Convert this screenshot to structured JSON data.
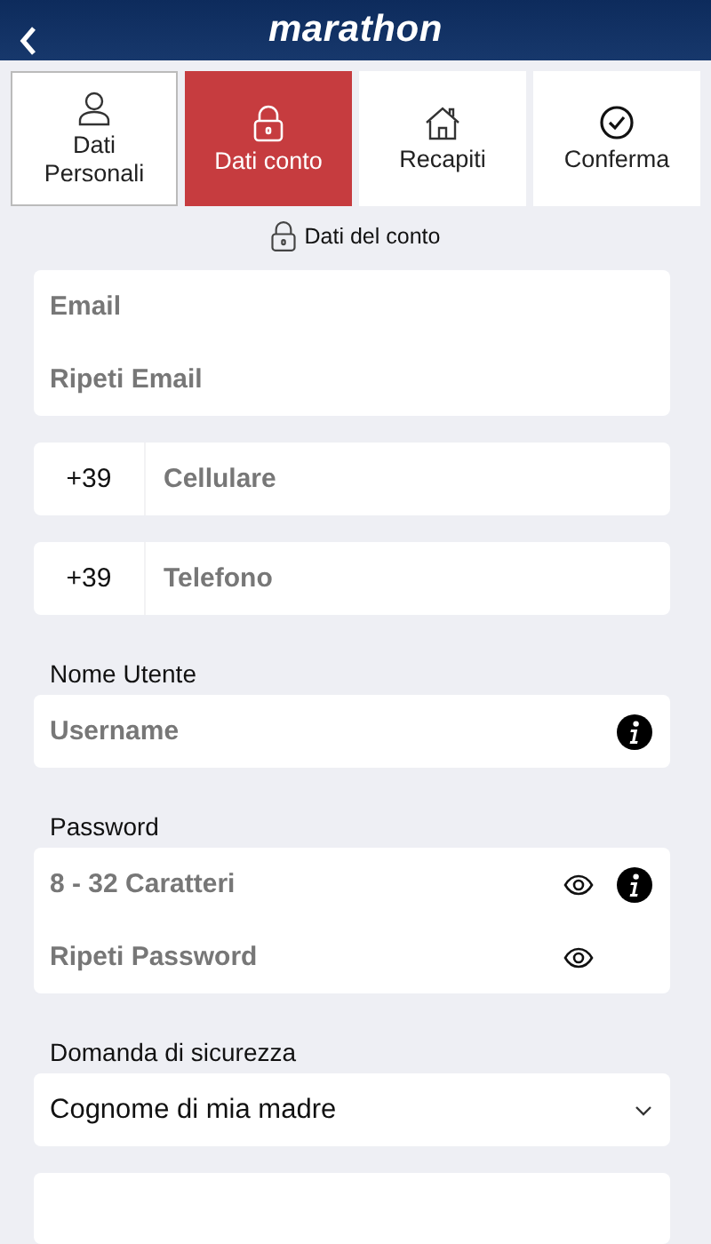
{
  "header": {
    "title": "marathon"
  },
  "steps": [
    {
      "label": "Dati Personali",
      "selected": false
    },
    {
      "label": "Dati conto",
      "selected": true
    },
    {
      "label": "Recapiti",
      "selected": false
    },
    {
      "label": "Conferma",
      "selected": false
    }
  ],
  "section_title": "Dati del conto",
  "groups": [
    {
      "fields": [
        {
          "kind": "text",
          "placeholder": "Email"
        },
        {
          "kind": "text",
          "placeholder": "Ripeti Email"
        }
      ]
    },
    {
      "fields": [
        {
          "kind": "phone",
          "prefix": "+39",
          "placeholder": "Cellulare"
        }
      ]
    },
    {
      "fields": [
        {
          "kind": "phone",
          "prefix": "+39",
          "placeholder": "Telefono"
        }
      ]
    },
    {
      "label": "Nome Utente",
      "fields": [
        {
          "kind": "text",
          "placeholder": "Username",
          "info": true
        }
      ]
    },
    {
      "label": "Password",
      "fields": [
        {
          "kind": "text",
          "placeholder": "8 - 32 Caratteri",
          "info": true,
          "reveal_toggle": true
        },
        {
          "kind": "text",
          "placeholder": "Ripeti Password",
          "reveal_toggle": true
        }
      ]
    },
    {
      "label": "Domanda di sicurezza",
      "fields": [
        {
          "kind": "select",
          "value": "Cognome di mia madre"
        }
      ]
    }
  ]
}
